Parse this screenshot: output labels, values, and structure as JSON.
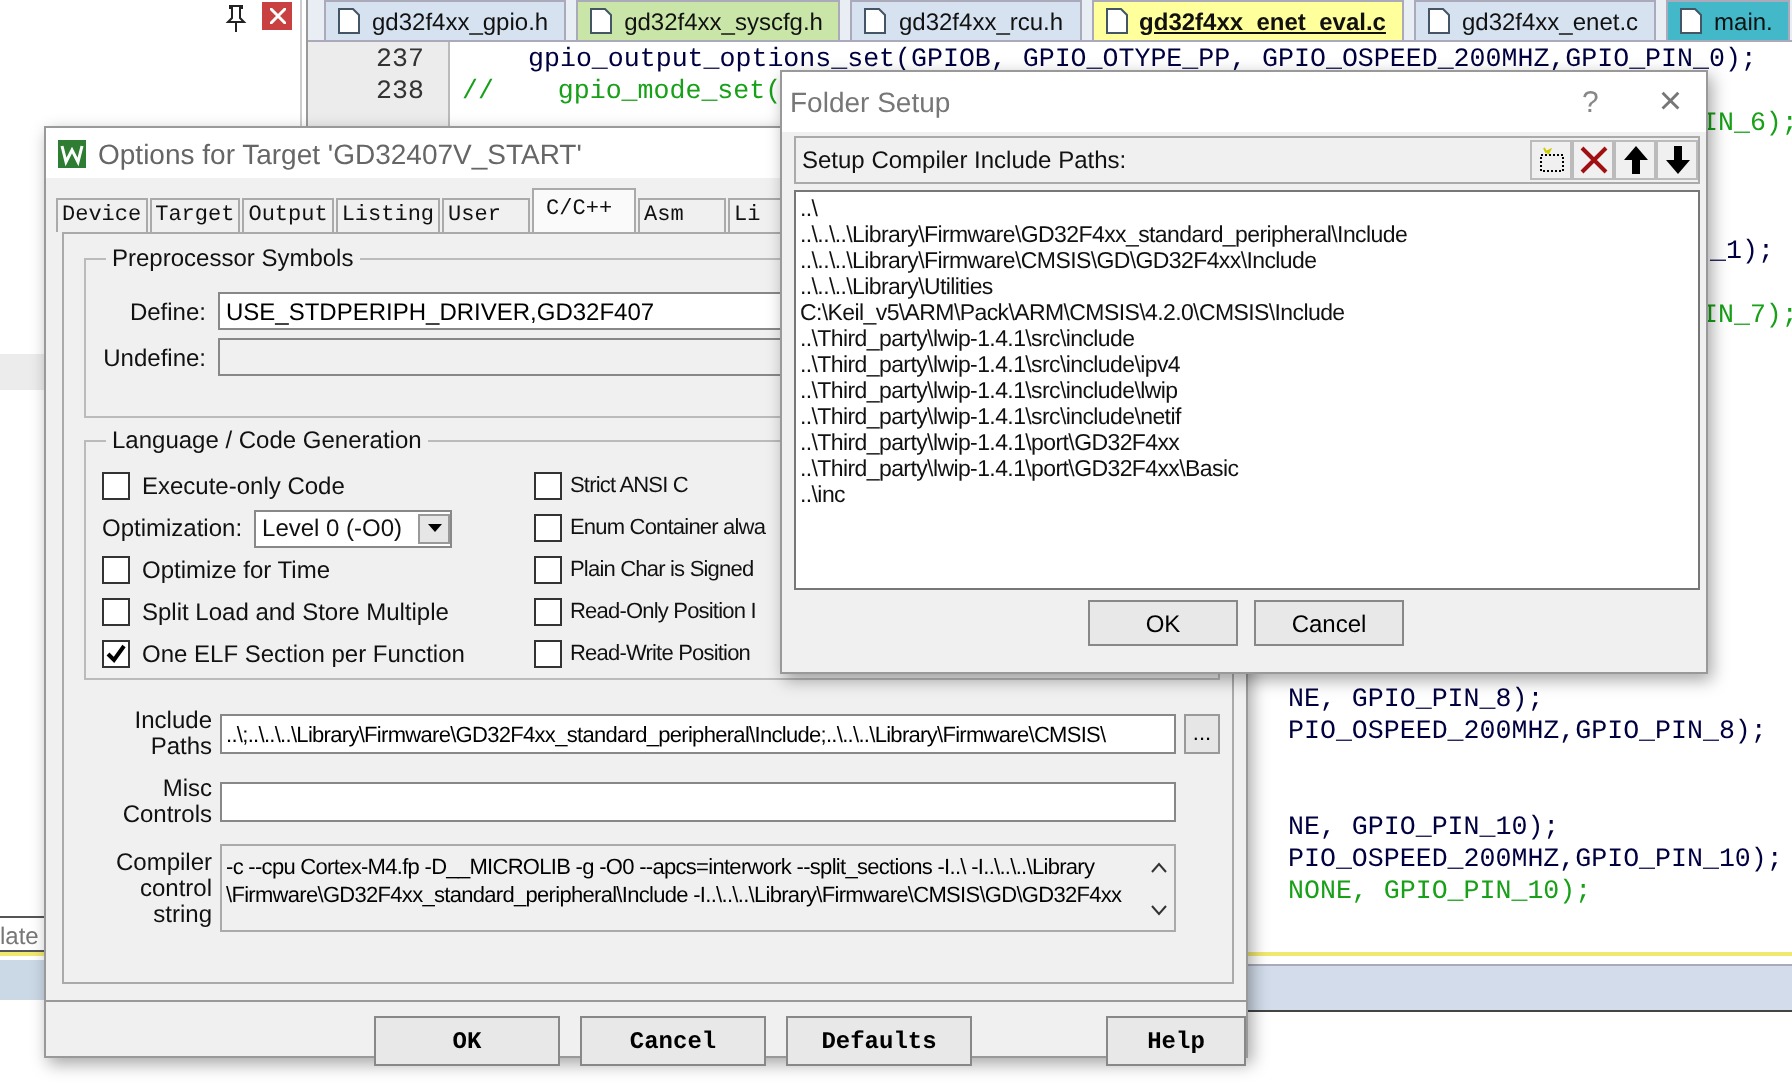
{
  "side_panel": {
    "caption": "late"
  },
  "editor": {
    "tabs": [
      {
        "label": "gd32f4xx_gpio.h",
        "selected": false,
        "color": "#d6e2f0"
      },
      {
        "label": "gd32f4xx_syscfg.h",
        "selected": false,
        "color": "#c9e6a8"
      },
      {
        "label": "gd32f4xx_rcu.h",
        "selected": false,
        "color": "#d6e2f0"
      },
      {
        "label": "gd32f4xx_enet_eval.c",
        "selected": true,
        "color": "#ffff9c"
      },
      {
        "label": "gd32f4xx_enet.c",
        "selected": false,
        "color": "#d6e2f0"
      },
      {
        "label": "main.",
        "selected": false,
        "color": "#42b8c8"
      }
    ],
    "lines": [
      {
        "number": "237",
        "text": "gpio_output_options_set(GPIOB, GPIO_OTYPE_PP, GPIO_OSPEED_200MHZ,GPIO_PIN_0);",
        "comment": false
      },
      {
        "number": "238",
        "text": "//    gpio_mode_set(",
        "comment": true
      },
      {
        "text": "IN_6);",
        "comment": true
      },
      {
        "text": "_1);",
        "comment": false
      },
      {
        "text": "IN_7);",
        "comment": true
      },
      {
        "text": "NE, GPIO_PIN_8);",
        "comment": false
      },
      {
        "text": "PIO_OSPEED_200MHZ,GPIO_PIN_8);",
        "comment": false
      },
      {
        "text": "NE, GPIO_PIN_10);",
        "comment": false
      },
      {
        "text": "PIO_OSPEED_200MHZ,GPIO_PIN_10);",
        "comment": false
      },
      {
        "text": "NONE, GPIO_PIN_10);",
        "comment": true
      }
    ]
  },
  "options_dialog": {
    "title": "Options for Target 'GD32407V_START'",
    "tabs": [
      {
        "label": "Device",
        "selected": false
      },
      {
        "label": "Target",
        "selected": false
      },
      {
        "label": "Output",
        "selected": false
      },
      {
        "label": "Listing",
        "selected": false
      },
      {
        "label": "User",
        "selected": false
      },
      {
        "label": "C/C++",
        "selected": true
      },
      {
        "label": "Asm",
        "selected": false
      },
      {
        "label": "Li",
        "selected": false
      }
    ],
    "preprocessor": {
      "title": "Preprocessor Symbols",
      "define_label": "Define:",
      "define_value": "USE_STDPERIPH_DRIVER,GD32F407",
      "undefine_label": "Undefine:"
    },
    "language": {
      "title": "Language / Code Generation",
      "left": [
        {
          "kind": "checkbox",
          "label": "Execute-only Code",
          "checked": false
        },
        {
          "kind": "select",
          "label": "Optimization:",
          "value": "Level 0 (-O0)"
        },
        {
          "kind": "checkbox",
          "label": "Optimize for Time",
          "checked": false
        },
        {
          "kind": "checkbox",
          "label": "Split Load and Store Multiple",
          "checked": false
        },
        {
          "kind": "checkbox",
          "label": "One ELF Section per Function",
          "checked": true
        }
      ],
      "right": [
        {
          "kind": "checkbox",
          "label": "Strict ANSI C",
          "checked": false
        },
        {
          "kind": "checkbox",
          "label": "Enum Container alwa",
          "checked": false
        },
        {
          "kind": "checkbox",
          "label": "Plain Char is Signed",
          "checked": false
        },
        {
          "kind": "checkbox",
          "label": "Read-Only Position I",
          "checked": false
        },
        {
          "kind": "checkbox",
          "label": "Read-Write Position",
          "checked": false
        }
      ]
    },
    "include_paths": {
      "label_1": "Include",
      "label_2": "Paths",
      "value": "..\\;..\\..\\..\\Library\\Firmware\\GD32F4xx_standard_peripheral\\Include;..\\..\\..\\Library\\Firmware\\CMSIS\\",
      "browse": "..."
    },
    "misc_controls": {
      "label_1": "Misc",
      "label_2": "Controls"
    },
    "compiler_string": {
      "label_1": "Compiler",
      "label_2": "control",
      "label_3": "string",
      "lines": [
        "-c --cpu Cortex-M4.fp -D__MICROLIB -g -O0 --apcs=interwork --split_sections -I..\\ -I..\\..\\..\\Library",
        "\\Firmware\\GD32F4xx_standard_peripheral\\Include -I..\\..\\..\\Library\\Firmware\\CMSIS\\GD\\GD32F4xx"
      ]
    },
    "buttons": [
      "OK",
      "Cancel",
      "Defaults",
      "Help"
    ]
  },
  "folder_setup": {
    "title": "Folder Setup",
    "help": "?",
    "close": "×",
    "header": "Setup Compiler Include Paths:",
    "paths": [
      "..\\",
      "..\\..\\..\\Library\\Firmware\\GD32F4xx_standard_peripheral\\Include",
      "..\\..\\..\\Library\\Firmware\\CMSIS\\GD\\GD32F4xx\\Include",
      "..\\..\\..\\Library\\Utilities",
      "C:\\Keil_v5\\ARM\\Pack\\ARM\\CMSIS\\4.2.0\\CMSIS\\Include",
      "..\\Third_party\\lwip-1.4.1\\src\\include",
      "..\\Third_party\\lwip-1.4.1\\src\\include\\ipv4",
      "..\\Third_party\\lwip-1.4.1\\src\\include\\lwip",
      "..\\Third_party\\lwip-1.4.1\\src\\include\\netif",
      "..\\Third_party\\lwip-1.4.1\\port\\GD32F4xx",
      "..\\Third_party\\lwip-1.4.1\\port\\GD32F4xx\\Basic",
      "..\\inc"
    ],
    "buttons": [
      "OK",
      "Cancel"
    ]
  }
}
